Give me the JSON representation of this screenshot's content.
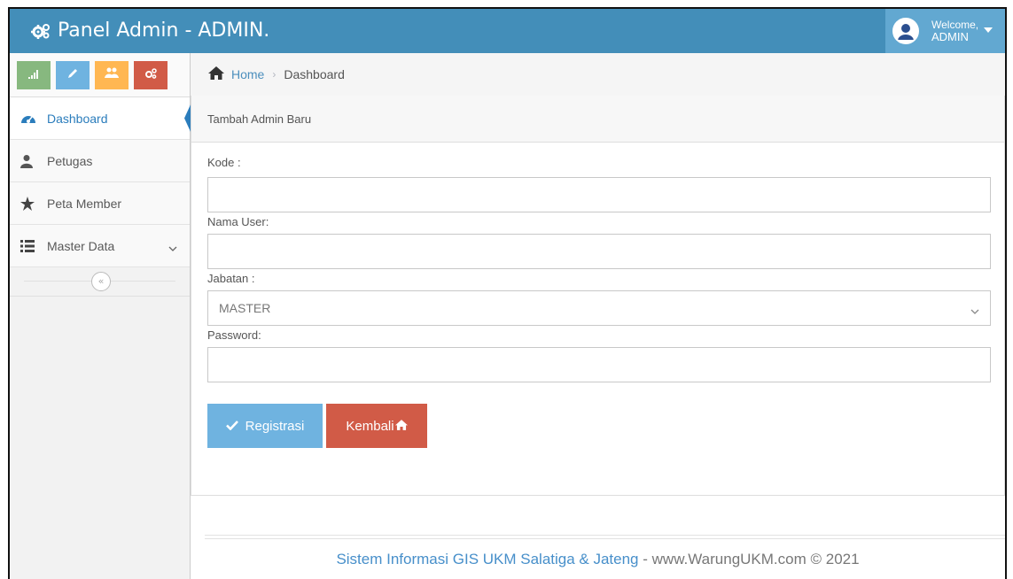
{
  "navbar": {
    "brand_text": "Panel Admin - ADMIN.",
    "brand_icon": "cogs-icon",
    "welcome_text": "Welcome,",
    "user_name": "ADMIN"
  },
  "shortcuts": [
    {
      "icon": "signal-icon",
      "color": "#87b87f"
    },
    {
      "icon": "pencil-icon",
      "color": "#6fb3e0"
    },
    {
      "icon": "users-icon",
      "color": "#ffb752"
    },
    {
      "icon": "cogs-icon",
      "color": "#d15b47"
    }
  ],
  "sidebar": {
    "items": [
      {
        "label": "Dashboard",
        "icon": "dashboard-icon",
        "active": true
      },
      {
        "label": "Petugas",
        "icon": "user-icon"
      },
      {
        "label": "Peta Member",
        "icon": "star-icon"
      },
      {
        "label": "Master Data",
        "icon": "list-icon",
        "has_submenu": true
      }
    ],
    "collapse_symbol": "«"
  },
  "breadcrumb": {
    "home": "Home",
    "current": "Dashboard"
  },
  "widget": {
    "title": "Tambah Admin Baru"
  },
  "form": {
    "kode_label": "Kode :",
    "kode_value": "",
    "nama_label": "Nama User:",
    "nama_value": "",
    "jabatan_label": "Jabatan :",
    "jabatan_value": "MASTER",
    "password_label": "Password:",
    "password_value": ""
  },
  "buttons": {
    "register": "Registrasi",
    "back": "Kembali"
  },
  "footer": {
    "brand": "Sistem Informasi GIS UKM Salatiga & Jateng",
    "rest": " - www.WarungUKM.com © 2021"
  },
  "colors": {
    "navbar": "#438eb9",
    "accent": "#2b7dbc",
    "success": "#87b87f",
    "info": "#6fb3e0",
    "warning": "#ffb752",
    "danger": "#d15b47"
  }
}
